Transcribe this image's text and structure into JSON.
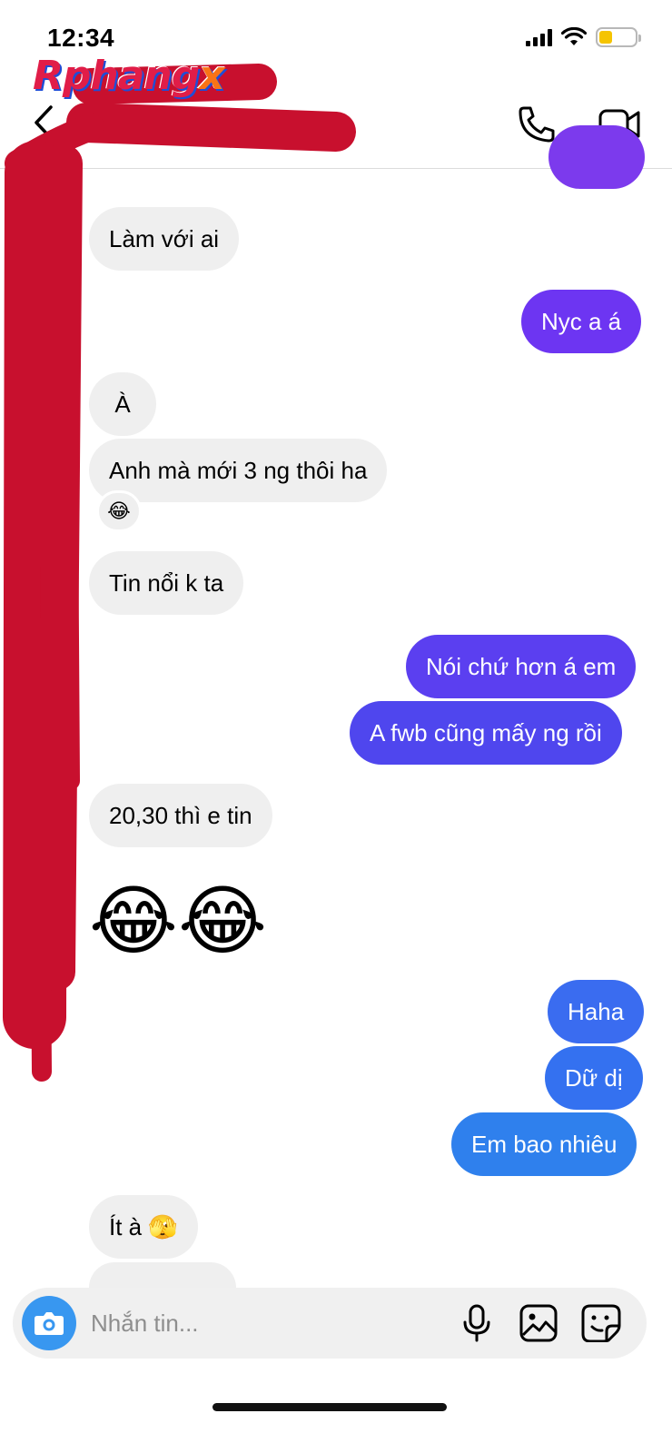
{
  "status_bar": {
    "time": "12:34",
    "battery_color": "#f5c400"
  },
  "watermark": {
    "text_main": "Rphang",
    "text_x": "x"
  },
  "header": {
    "back_icon": "chevron-left-icon",
    "call_icon": "phone-icon",
    "video_icon": "video-camera-icon"
  },
  "colors": {
    "incoming_bubble": "#efefef",
    "outgoing_purple": "#7c3aed",
    "outgoing_blue": "#2f80ed",
    "redaction": "#c8102e"
  },
  "messages": [
    {
      "from": "them",
      "text": "Làm với ai"
    },
    {
      "from": "me",
      "text": "Nyc a á"
    },
    {
      "from": "them",
      "text": "À"
    },
    {
      "from": "them",
      "text": "Anh mà mới 3 ng thôi ha",
      "reaction": "😂"
    },
    {
      "from": "them",
      "text": "Tin nổi k ta"
    },
    {
      "from": "me",
      "text": "Nói chứ hơn á em"
    },
    {
      "from": "me",
      "text": "A fwb cũng mấy ng rồi"
    },
    {
      "from": "them",
      "text": "20,30 thì e tin"
    },
    {
      "from": "them",
      "text": "😂😂"
    },
    {
      "from": "me",
      "text": "Haha"
    },
    {
      "from": "me",
      "text": "Dữ dị"
    },
    {
      "from": "me",
      "text": "Em bao nhiêu"
    },
    {
      "from": "them",
      "text": "Ít à 🫣"
    }
  ],
  "composer": {
    "placeholder": "Nhắn tin...",
    "camera_icon": "camera-icon",
    "mic_icon": "microphone-icon",
    "gallery_icon": "image-icon",
    "sticker_icon": "sticker-icon"
  }
}
